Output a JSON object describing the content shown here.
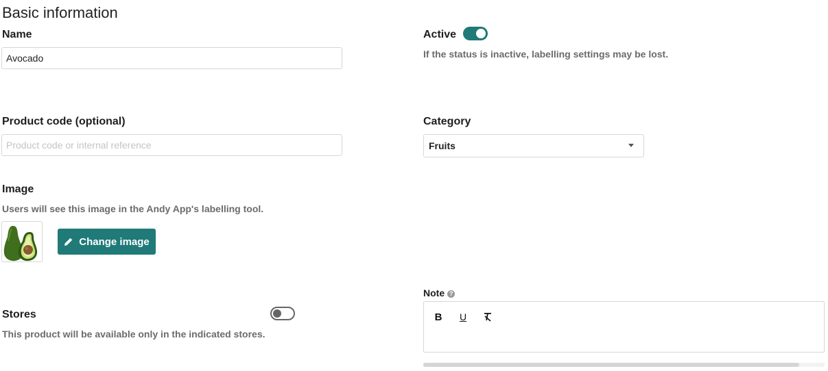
{
  "section": {
    "title": "Basic information"
  },
  "name_field": {
    "label": "Name",
    "value": "Avocado"
  },
  "active": {
    "label": "Active",
    "enabled": true,
    "help": "If the status is inactive, labelling settings may be lost."
  },
  "product_code": {
    "label": "Product code (optional)",
    "value": "",
    "placeholder": "Product code or internal reference"
  },
  "category": {
    "label": "Category",
    "selected": "Fruits"
  },
  "image": {
    "label": "Image",
    "help": "Users will see this image in the Andy App's labelling tool.",
    "alt": "Avocado",
    "button_label": "Change image"
  },
  "stores": {
    "label": "Stores",
    "enabled": false,
    "help": "This product will be available only in the indicated stores."
  },
  "note": {
    "label": "Note",
    "toolbar": {
      "bold": "B",
      "underline": "U",
      "clear_format": "clear-format-icon"
    }
  },
  "colors": {
    "accent": "#1f7a78",
    "label": "#1e1e1e",
    "help": "#6b6b6b",
    "border": "#d6d6d6"
  }
}
